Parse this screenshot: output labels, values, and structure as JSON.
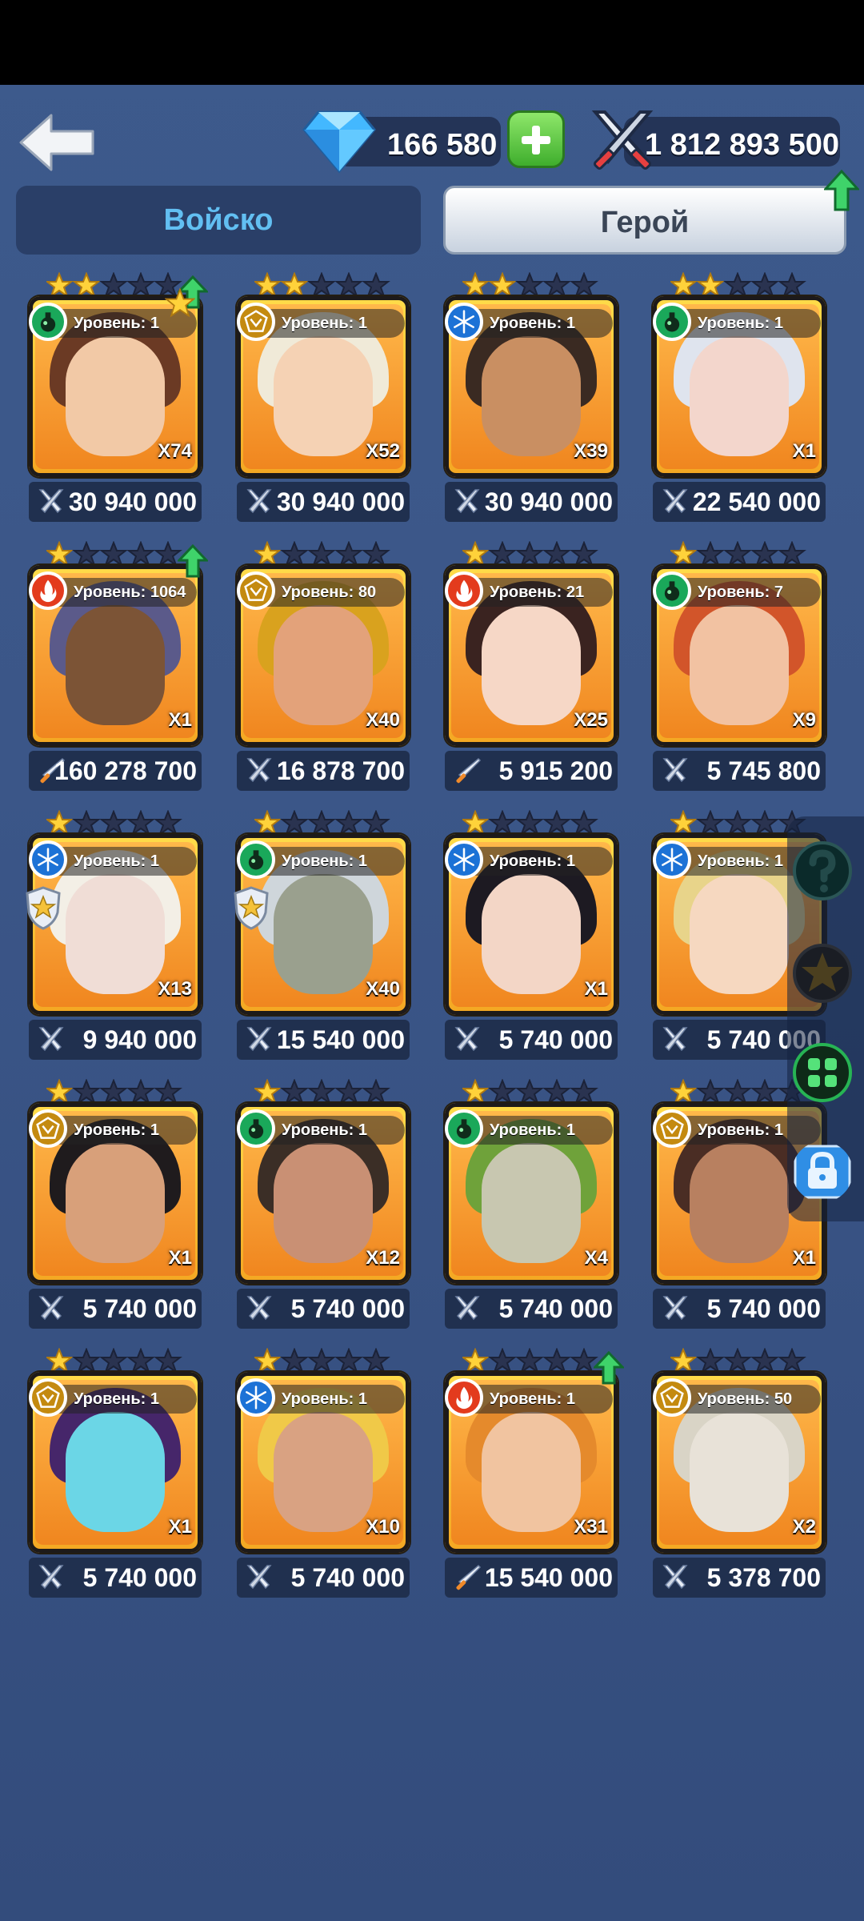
{
  "header": {
    "gems": "166 580",
    "power_total": "1 812 893 500"
  },
  "tabs": [
    {
      "label": "Войско",
      "active": false
    },
    {
      "label": "Герой",
      "active": true
    }
  ],
  "colors": {
    "fire": "#e33b1d",
    "poison": "#1aa85a",
    "ice": "#1c72d6",
    "light": "#c48a10",
    "card_gold": "#f4a722",
    "tab_active_text": "#3a4556",
    "tab_inactive_text": "#62bff2"
  },
  "heroes": [
    {
      "stars": 2,
      "element": "poison",
      "level": "Уровень: 1",
      "count": "X74",
      "power": "30 940 000",
      "power_icon": "swords",
      "upgrade": true,
      "upgrade_star": true
    },
    {
      "stars": 2,
      "element": "light",
      "level": "Уровень: 1",
      "count": "X52",
      "power": "30 940 000",
      "power_icon": "swords"
    },
    {
      "stars": 2,
      "element": "ice",
      "level": "Уровень: 1",
      "count": "X39",
      "power": "30 940 000",
      "power_icon": "swords"
    },
    {
      "stars": 2,
      "element": "poison",
      "level": "Уровень: 1",
      "count": "X1",
      "power": "22 540 000",
      "power_icon": "swords"
    },
    {
      "stars": 1,
      "element": "fire",
      "level": "Уровень: 1064",
      "count": "X1",
      "power": "160 278 700",
      "power_icon": "sword",
      "upgrade": true
    },
    {
      "stars": 1,
      "element": "light",
      "level": "Уровень: 80",
      "count": "X40",
      "power": "16 878 700",
      "power_icon": "swords"
    },
    {
      "stars": 1,
      "element": "fire",
      "level": "Уровень: 21",
      "count": "X25",
      "power": "5 915 200",
      "power_icon": "sword"
    },
    {
      "stars": 1,
      "element": "poison",
      "level": "Уровень: 7",
      "count": "X9",
      "power": "5 745 800",
      "power_icon": "swords"
    },
    {
      "stars": 1,
      "element": "ice",
      "level": "Уровень: 1",
      "count": "X13",
      "power": "9 940 000",
      "power_icon": "swords",
      "shield": true
    },
    {
      "stars": 1,
      "element": "poison",
      "level": "Уровень: 1",
      "count": "X40",
      "power": "15 540 000",
      "power_icon": "swords",
      "shield": true
    },
    {
      "stars": 1,
      "element": "ice",
      "level": "Уровень: 1",
      "count": "X1",
      "power": "5 740 000",
      "power_icon": "swords"
    },
    {
      "stars": 1,
      "element": "ice",
      "level": "Уровень: 1",
      "count": "",
      "power": "5 740 000",
      "power_icon": "swords"
    },
    {
      "stars": 1,
      "element": "light",
      "level": "Уровень: 1",
      "count": "X1",
      "power": "5 740 000",
      "power_icon": "swords"
    },
    {
      "stars": 1,
      "element": "poison",
      "level": "Уровень: 1",
      "count": "X12",
      "power": "5 740 000",
      "power_icon": "swords"
    },
    {
      "stars": 1,
      "element": "poison",
      "level": "Уровень: 1",
      "count": "X4",
      "power": "5 740 000",
      "power_icon": "swords"
    },
    {
      "stars": 1,
      "element": "light",
      "level": "Уровень: 1",
      "count": "X1",
      "power": "5 740 000",
      "power_icon": "swords"
    },
    {
      "stars": 1,
      "element": "light",
      "level": "Уровень: 1",
      "count": "X1",
      "power": "5 740 000",
      "power_icon": "swords"
    },
    {
      "stars": 1,
      "element": "ice",
      "level": "Уровень: 1",
      "count": "X10",
      "power": "5 740 000",
      "power_icon": "swords"
    },
    {
      "stars": 1,
      "element": "fire",
      "level": "Уровень: 1",
      "count": "X31",
      "power": "15 540 000",
      "power_icon": "sword",
      "upgrade": true
    },
    {
      "stars": 1,
      "element": "light",
      "level": "Уровень: 50",
      "count": "X2",
      "power": "5 378 700",
      "power_icon": "swords"
    }
  ],
  "side_panel": [
    {
      "icon": "help-icon"
    },
    {
      "icon": "star-icon"
    },
    {
      "icon": "grid-icon"
    },
    {
      "icon": "lock-icon"
    }
  ]
}
